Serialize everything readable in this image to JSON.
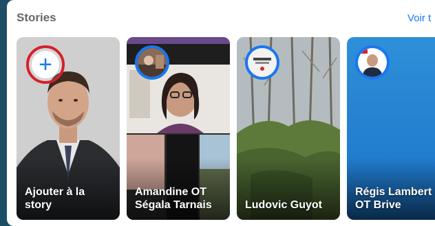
{
  "header": {
    "title": "Stories",
    "see_all": "Voir t"
  },
  "stories": [
    {
      "label": "Ajouter à la story"
    },
    {
      "label": "Amandine OT Ségala Tarnais"
    },
    {
      "label": "Ludovic Guyot"
    },
    {
      "label": "Régis Lambert OT Brive"
    }
  ],
  "colors": {
    "accent": "#1877f2",
    "highlight_ring": "#d6202a",
    "page_bg": "#1c4f66"
  }
}
